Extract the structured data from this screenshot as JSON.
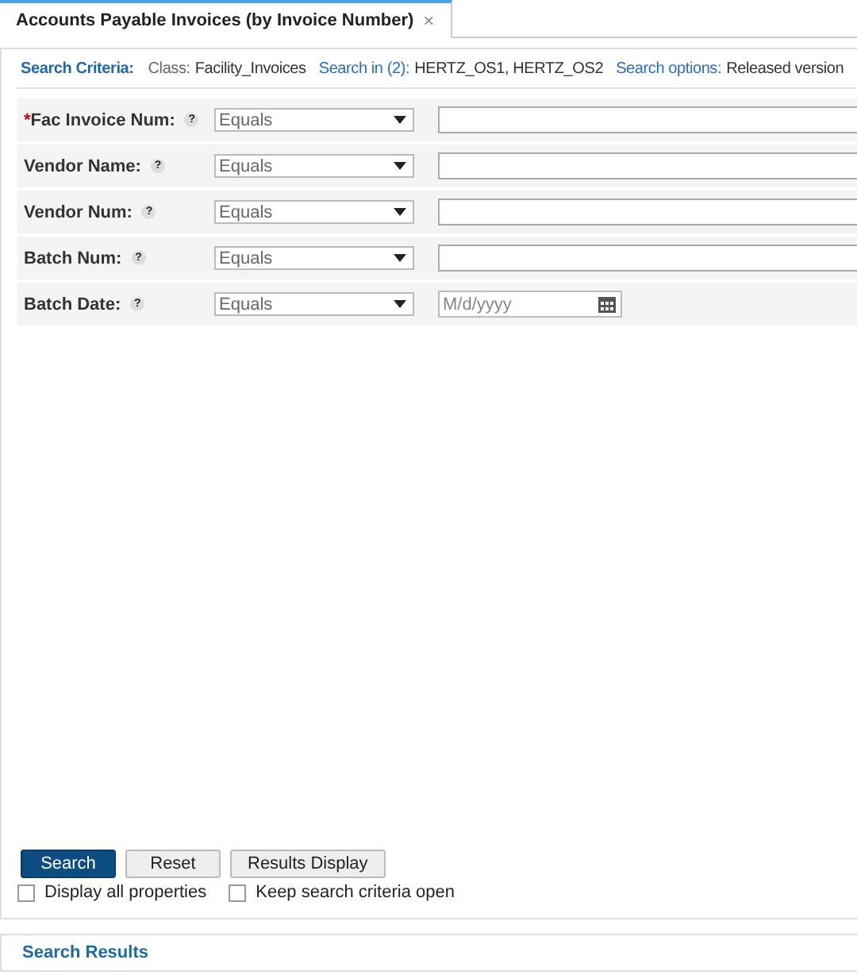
{
  "tabs": [
    {
      "label": "Accounts Payable Invoices (by Invoice Number)",
      "close": "×",
      "selected": true
    }
  ],
  "criteria": {
    "title": "Search Criteria:",
    "class_label": "Class:",
    "class_value": "Facility_Invoices",
    "search_in_label": "Search in (2):",
    "search_in_value": "HERTZ_OS1, HERTZ_OS2",
    "options_label": "Search options:",
    "options_value": "Released version"
  },
  "fields": [
    {
      "label": "Fac Invoice Num:",
      "required": true,
      "operator": "Equals",
      "kind": "text"
    },
    {
      "label": "Vendor Name:",
      "required": false,
      "operator": "Equals",
      "kind": "text"
    },
    {
      "label": "Vendor Num:",
      "required": false,
      "operator": "Equals",
      "kind": "text"
    },
    {
      "label": "Batch Num:",
      "required": false,
      "operator": "Equals",
      "kind": "text"
    },
    {
      "label": "Batch Date:",
      "required": false,
      "operator": "Equals",
      "kind": "date",
      "placeholder": "M/d/yyyy"
    }
  ],
  "help": "?",
  "required_mark": "*",
  "buttons": [
    {
      "label": "Search",
      "kind": "primary"
    },
    {
      "label": "Reset",
      "kind": "secondary"
    },
    {
      "label": "Results Display",
      "kind": "secondary"
    }
  ],
  "options": [
    {
      "label": "Display all properties",
      "checked": false
    },
    {
      "label": "Keep search criteria open",
      "checked": false
    }
  ],
  "results": {
    "title": "Search Results"
  }
}
